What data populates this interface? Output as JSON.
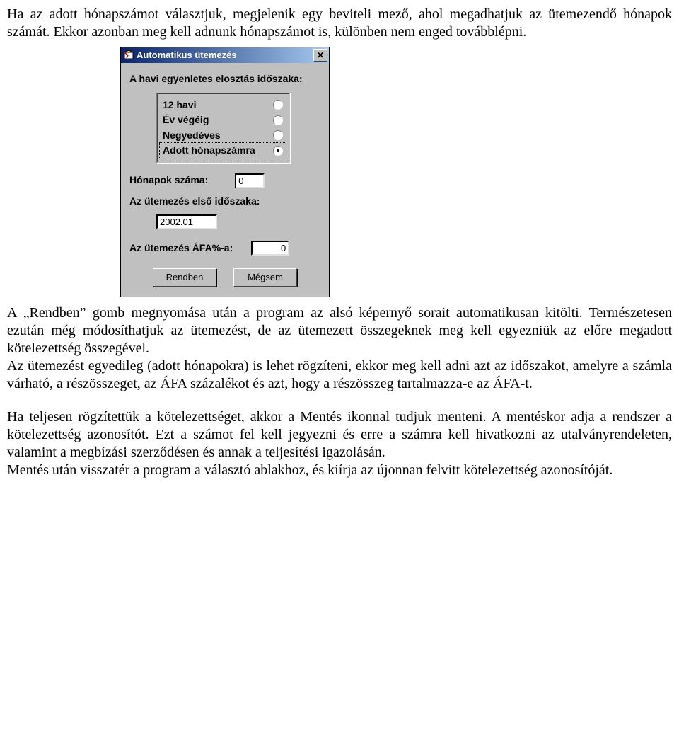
{
  "para1": "Ha az adott hónapszámot választjuk, megjelenik egy beviteli mező, ahol megadhatjuk az ütemezendő hónapok számát. Ekkor azonban meg kell adnunk hónapszámot is, különben nem enged továbblépni.",
  "dialog": {
    "title": "Automatikus ütemezés",
    "heading": "A havi egyenletes elosztás időszaka:",
    "options": [
      {
        "label": "12 havi",
        "checked": false
      },
      {
        "label": "Év végéig",
        "checked": false
      },
      {
        "label": "Negyedéves",
        "checked": false
      },
      {
        "label": "Adott hónapszámra",
        "checked": true
      }
    ],
    "months_label": "Hónapok száma:",
    "months_value": "0",
    "first_period_label": "Az ütemezés első időszaka:",
    "first_period_value": "2002.01",
    "vat_label": "Az ütemezés ÁFA%-a:",
    "vat_value": "0",
    "ok_label": "Rendben",
    "cancel_label": "Mégsem",
    "close_glyph": "✕"
  },
  "para2": "A „Rendben” gomb megnyomása után a program az alsó képernyő sorait automatikusan kitölti. Természetesen ezután még módosíthatjuk az ütemezést, de az ütemezett összegeknek meg kell egyezniük az előre megadott kötelezettség összegével.",
  "para3": "Az ütemezést egyedileg (adott hónapokra) is lehet rögzíteni, ekkor meg kell adni azt az időszakot, amelyre a számla várható, a részösszeget, az ÁFA százalékot és azt, hogy a részösszeg tartalmazza-e az ÁFA-t.",
  "para4": "Ha teljesen rögzítettük a kötelezettséget, akkor a Mentés ikonnal tudjuk menteni. A mentéskor adja a rendszer a kötelezettség azonosítót. Ezt a számot fel kell jegyezni és erre a számra kell hivatkozni az utalványrendeleten, valamint a megbízási szerződésen és annak a teljesítési igazolásán.",
  "para5": "Mentés után visszatér a program a választó ablakhoz, és kiírja az újonnan felvitt kötelezettség azonosítóját."
}
